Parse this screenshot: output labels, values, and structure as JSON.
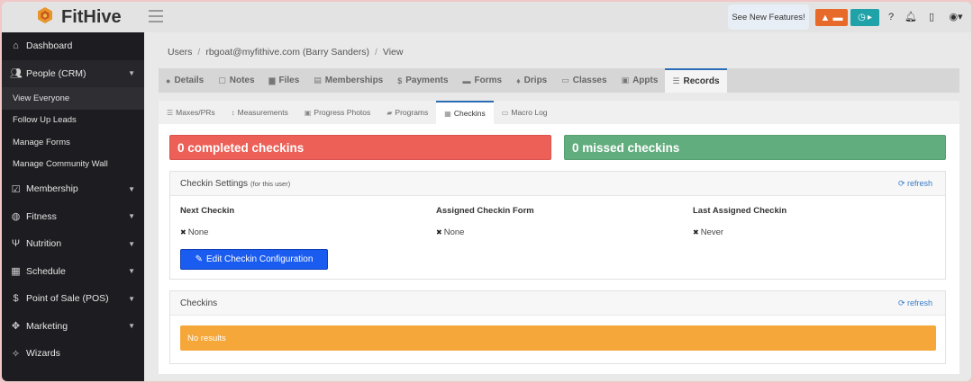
{
  "brand": {
    "name": "FitHive"
  },
  "topbar": {
    "new_features": "See New Features!",
    "alert_icon": "warning-icon",
    "card_icon": "credit-card-icon"
  },
  "sidebar": {
    "items": [
      {
        "label": "Dashboard",
        "icon": "home-icon"
      },
      {
        "label": "People (CRM)",
        "icon": "users-icon"
      },
      {
        "label": "Membership",
        "icon": "check-square-icon"
      },
      {
        "label": "Fitness",
        "icon": "fitness-icon"
      },
      {
        "label": "Nutrition",
        "icon": "utensils-icon"
      },
      {
        "label": "Schedule",
        "icon": "calendar-icon"
      },
      {
        "label": "Point of Sale (POS)",
        "icon": "dollar-icon"
      },
      {
        "label": "Marketing",
        "icon": "bullhorn-icon"
      },
      {
        "label": "Wizards",
        "icon": "wand-icon"
      }
    ],
    "sub_items": [
      "View Everyone",
      "Follow Up Leads",
      "Manage Forms",
      "Manage Community Wall"
    ]
  },
  "breadcrumb": [
    "Users",
    "rbgoat@myfithive.com (Barry Sanders)",
    "View"
  ],
  "main_tabs": [
    "Details",
    "Notes",
    "Files",
    "Memberships",
    "Payments",
    "Forms",
    "Drips",
    "Classes",
    "Appts",
    "Records"
  ],
  "sub_tabs": [
    "Maxes/PRs",
    "Measurements",
    "Progress Photos",
    "Programs",
    "Checkins",
    "Macro Log"
  ],
  "stats": {
    "completed": "0 completed checkins",
    "missed": "0 missed checkins"
  },
  "settings": {
    "title": "Checkin Settings",
    "subtitle": "(for this user)",
    "refresh": "refresh",
    "columns": [
      {
        "header": "Next Checkin",
        "value": "None"
      },
      {
        "header": "Assigned Checkin Form",
        "value": "None"
      },
      {
        "header": "Last Assigned Checkin",
        "value": "Never"
      }
    ],
    "edit_button": "Edit Checkin Configuration"
  },
  "checkins": {
    "title": "Checkins",
    "refresh": "refresh",
    "empty": "No results"
  },
  "colors": {
    "accent": "#2a6db5",
    "danger": "#ec6057",
    "success": "#62ad7e",
    "warning": "#f5a73a",
    "primary_button": "#1b5cf0"
  }
}
